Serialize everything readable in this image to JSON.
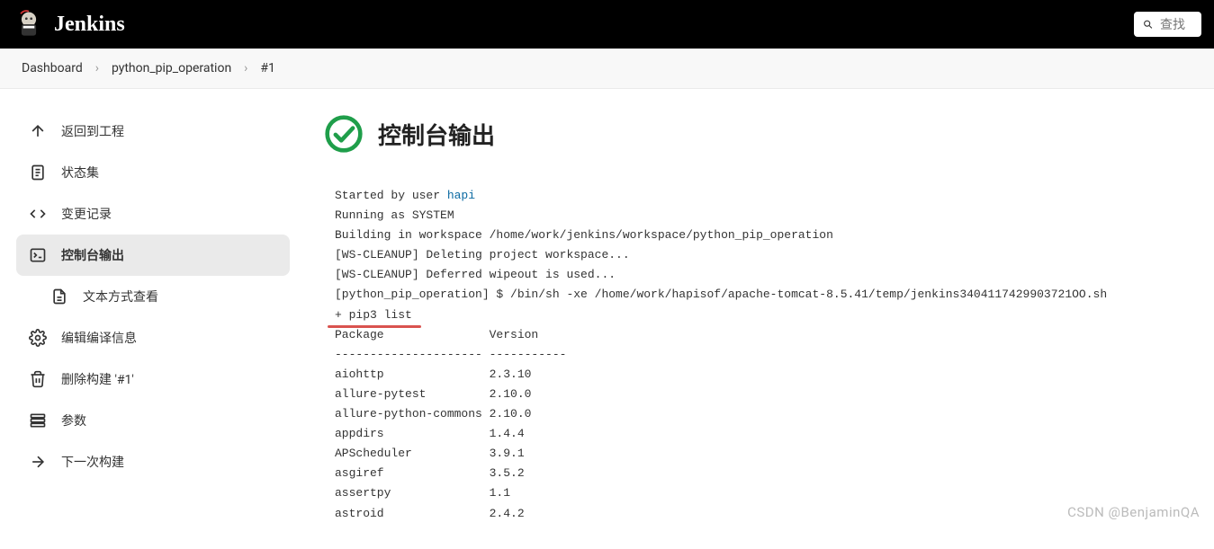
{
  "header": {
    "app_name": "Jenkins",
    "search_placeholder": "查找"
  },
  "breadcrumb": {
    "items": [
      "Dashboard",
      "python_pip_operation",
      "#1"
    ]
  },
  "sidebar": {
    "items": [
      {
        "id": "back",
        "label": "返回到工程"
      },
      {
        "id": "status",
        "label": "状态集"
      },
      {
        "id": "changes",
        "label": "变更记录"
      },
      {
        "id": "console",
        "label": "控制台输出"
      },
      {
        "id": "plaintext",
        "label": "文本方式查看"
      },
      {
        "id": "editbuild",
        "label": "编辑编译信息"
      },
      {
        "id": "delete",
        "label": "删除构建 '#1'"
      },
      {
        "id": "params",
        "label": "参数"
      },
      {
        "id": "nextbuild",
        "label": "下一次构建"
      }
    ]
  },
  "main": {
    "title": "控制台输出",
    "console": {
      "started_by": "Started by user ",
      "user_name": "hapi",
      "line_running": "Running as SYSTEM",
      "line_building": "Building in workspace /home/work/jenkins/workspace/python_pip_operation",
      "line_ws1": "[WS-CLEANUP] Deleting project workspace...",
      "line_ws2": "[WS-CLEANUP] Deferred wipeout is used...",
      "line_exec": "[python_pip_operation] $ /bin/sh -xe /home/work/hapisof/apache-tomcat-8.5.41/temp/jenkins3404117429903721OO.sh",
      "line_pip": "+ pip3 list",
      "pkg_header": "Package               Version",
      "pkg_divider": "--------------------- -----------",
      "packages": [
        {
          "name": "aiohttp",
          "version": "2.3.10"
        },
        {
          "name": "allure-pytest",
          "version": "2.10.0"
        },
        {
          "name": "allure-python-commons",
          "version": "2.10.0"
        },
        {
          "name": "appdirs",
          "version": "1.4.4"
        },
        {
          "name": "APScheduler",
          "version": "3.9.1"
        },
        {
          "name": "asgiref",
          "version": "3.5.2"
        },
        {
          "name": "assertpy",
          "version": "1.1"
        },
        {
          "name": "astroid",
          "version": "2.4.2"
        }
      ]
    }
  },
  "watermark": "CSDN @BenjaminQA"
}
